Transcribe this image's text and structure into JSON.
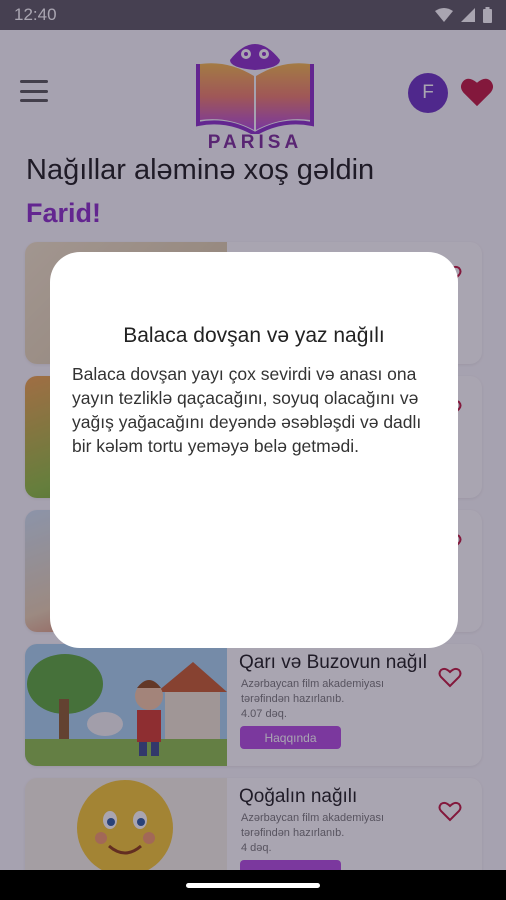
{
  "status": {
    "time": "12:40"
  },
  "header": {
    "logo_text": "PARISA",
    "avatar_letter": "F"
  },
  "welcome": {
    "line1": "Nağıllar aləminə xoş gəldin",
    "name": "Farid!"
  },
  "stories": [
    {
      "title": "",
      "subtitle": "",
      "duration": "",
      "button": ""
    },
    {
      "title": "",
      "subtitle": "",
      "duration": "",
      "button": ""
    },
    {
      "title": "",
      "subtitle": "",
      "duration": "",
      "button": ""
    },
    {
      "title": "Qarı və Buzovun nağıl",
      "subtitle": "Azərbaycan film akademiyası tərəfindən hazırlanıb.",
      "duration": "4.07  dəq.",
      "button": "Haqqında"
    },
    {
      "title": "Qoğalın nağılı",
      "subtitle": "Azərbaycan film akademiyası tərəfindən hazırlanıb.",
      "duration": "4  dəq.",
      "button": ""
    }
  ],
  "modal": {
    "title": "Balaca dovşan və yaz nağılı",
    "text": "Balaca dovşan yayı çox sevirdi və anası ona yayın tezliklə qaçacağını, soyuq olacağını və yağış yağacağını deyəndə əsəbləşdi və dadlı bir kələm tortu yeməyə belə getmədi."
  },
  "colors": {
    "accent": "#8b2cc8",
    "button": "#b24ae0",
    "favorite": "#c0143c"
  }
}
